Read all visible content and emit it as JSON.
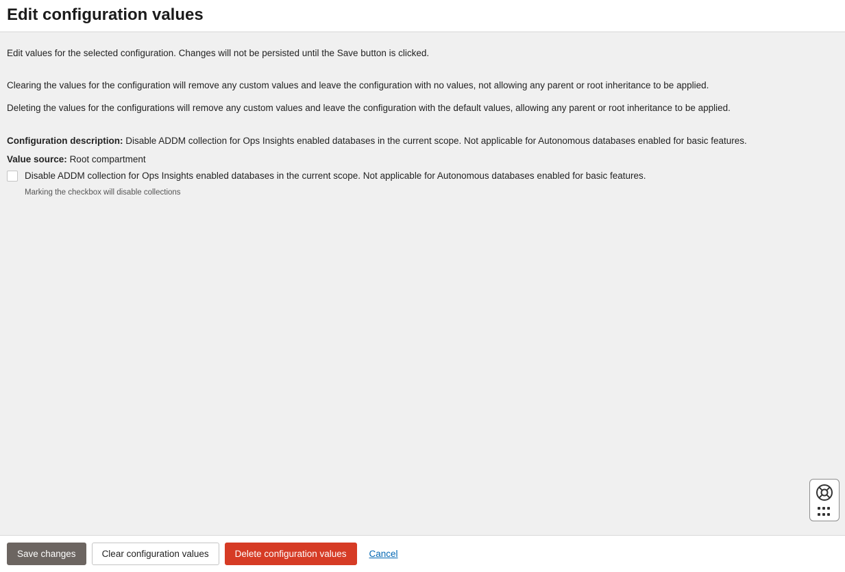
{
  "header": {
    "title": "Edit configuration values"
  },
  "content": {
    "intro": "Edit values for the selected configuration. Changes will not be persisted until the Save button is clicked.",
    "clearing_note": "Clearing the values for the configuration will remove any custom values and leave the configuration with no values, not allowing any parent or root inheritance to be applied.",
    "deleting_note": "Deleting the values for the configurations will remove any custom values and leave the configuration with the default values, allowing any parent or root inheritance to be applied.",
    "config_desc_label": "Configuration description:",
    "config_desc_value": "Disable ADDM collection for Ops Insights enabled databases in the current scope. Not applicable for Autonomous databases enabled for basic features.",
    "value_source_label": "Value source:",
    "value_source_value": "Root compartment",
    "checkbox_label": "Disable ADDM collection for Ops Insights enabled databases in the current scope. Not applicable for Autonomous databases enabled for basic features.",
    "checkbox_hint": "Marking the checkbox will disable collections"
  },
  "footer": {
    "save": "Save changes",
    "clear": "Clear configuration values",
    "delete": "Delete configuration values",
    "cancel": "Cancel"
  }
}
